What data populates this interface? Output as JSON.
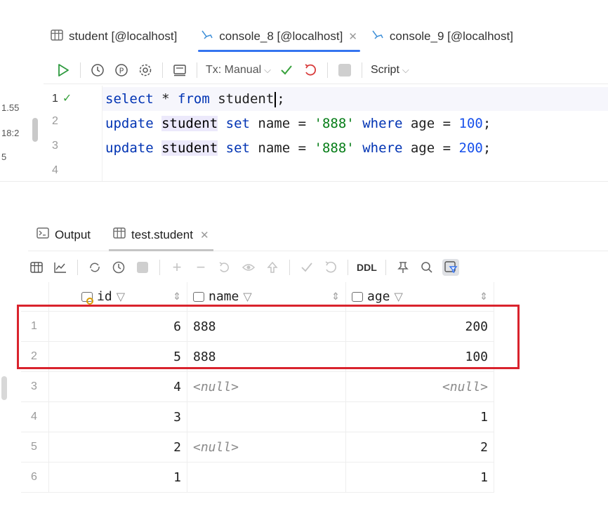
{
  "left_panel": {
    "fragments": [
      "1.55",
      "18:2",
      "5"
    ]
  },
  "editor_tabs": [
    {
      "label": "student [@localhost]",
      "icon": "table-icon",
      "active": false
    },
    {
      "label": "console_8 [@localhost]",
      "icon": "console-icon",
      "active": true,
      "closable": true
    },
    {
      "label": "console_9 [@localhost]",
      "icon": "console-icon",
      "active": false
    }
  ],
  "toolbar": {
    "tx_label": "Tx: Manual",
    "script_label": "Script",
    "icons": [
      "run-icon",
      "history-icon",
      "parameters-icon",
      "settings-icon",
      "layout-icon",
      "commit-icon",
      "rollback-icon",
      "stop-icon"
    ]
  },
  "editor": {
    "line_numbers": [
      "1",
      "2",
      "3",
      "4"
    ],
    "lines": [
      {
        "text": "select * from student;"
      },
      {
        "text": "update student set name = '888' where age = 100;"
      },
      {
        "text": "update student set name = '888' where age = 200;"
      },
      {
        "text": ""
      }
    ]
  },
  "result_tabs": [
    {
      "label": "Output",
      "icon": "output-icon",
      "active": false
    },
    {
      "label": "test.student",
      "icon": "table-icon",
      "active": true,
      "closable": true
    }
  ],
  "result_toolbar": {
    "ddl_label": "DDL"
  },
  "grid": {
    "columns": [
      {
        "name": "id"
      },
      {
        "name": "name"
      },
      {
        "name": "age"
      }
    ],
    "rows": [
      {
        "n": "1",
        "id": "6",
        "name": "888",
        "age": "200"
      },
      {
        "n": "2",
        "id": "5",
        "name": "888",
        "age": "100"
      },
      {
        "n": "3",
        "id": "4",
        "name": "<null>",
        "age": "<null>"
      },
      {
        "n": "4",
        "id": "3",
        "name": "",
        "age": "1"
      },
      {
        "n": "5",
        "id": "2",
        "name": "<null>",
        "age": "2"
      },
      {
        "n": "6",
        "id": "1",
        "name": "",
        "age": "1"
      }
    ]
  },
  "colors": {
    "accent": "#3574f0",
    "highlight_box": "#d9232d",
    "keyword": "#0033b3",
    "string": "#067d17",
    "number": "#1750eb"
  }
}
